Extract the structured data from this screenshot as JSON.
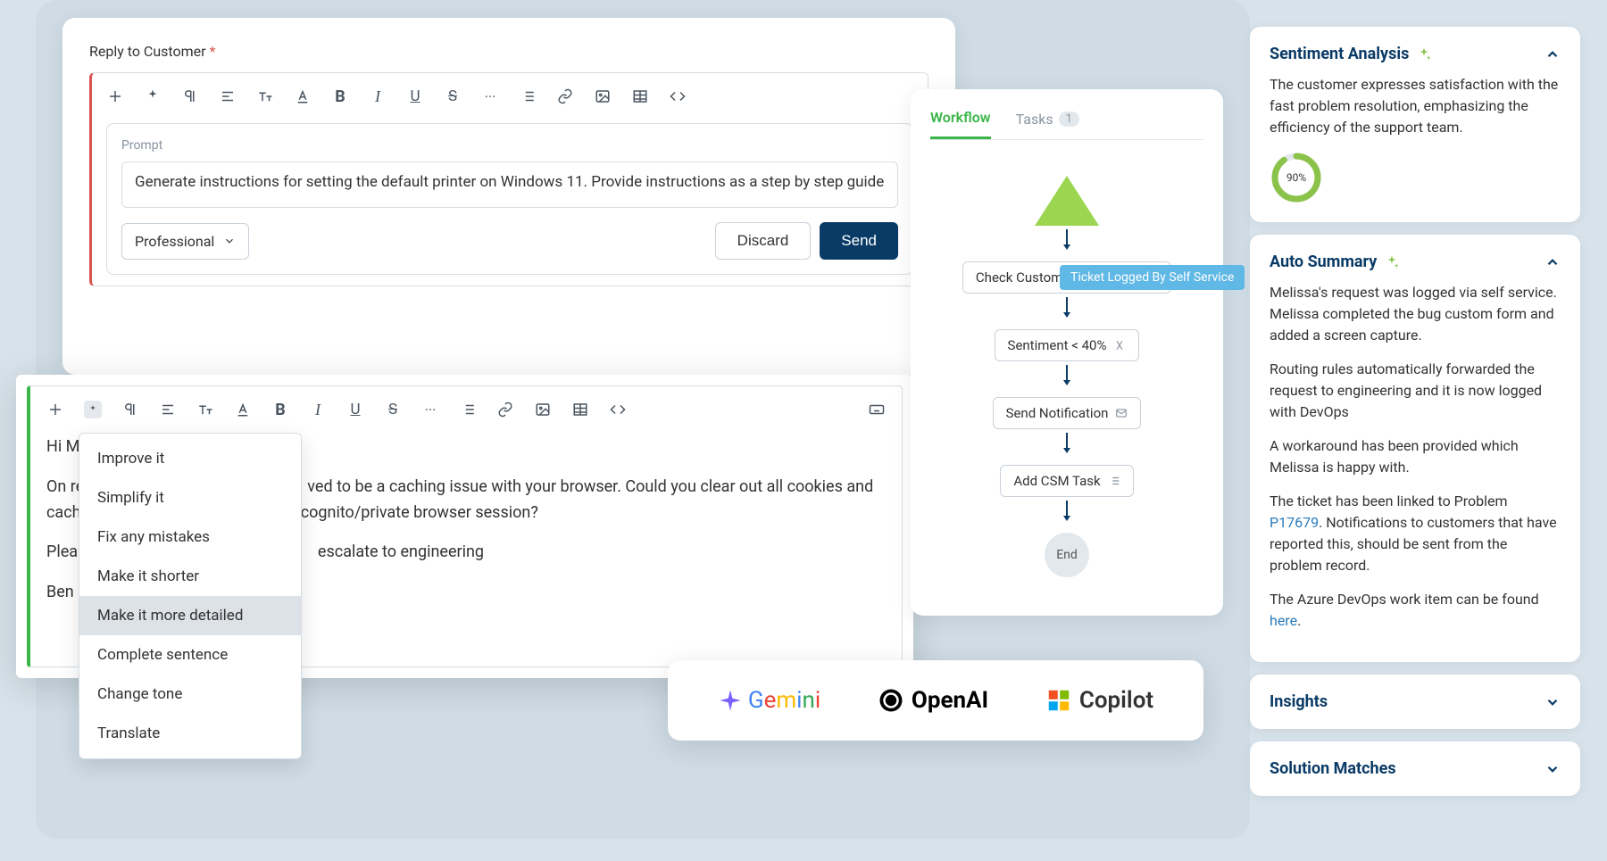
{
  "reply": {
    "label": "Reply to Customer",
    "required": "*",
    "promptLabel": "Prompt",
    "promptText": "Generate instructions for setting the default printer on Windows 11. Provide instructions as a step by step guide",
    "toneSelected": "Professional",
    "discard": "Discard",
    "send": "Send"
  },
  "editor2": {
    "line1": "Hi Me",
    "line2": "On re                                                        ved to be a caching issue with your browser. Could you clear out all cookies and cache                                                     cognito/private browser session?",
    "line3": "Please                                                        escalate to engineering",
    "line4": "Ben"
  },
  "dropdown": {
    "items": [
      "Improve it",
      "Simplify it",
      "Fix any mistakes",
      "Make it shorter",
      "Make it more detailed",
      "Complete sentence",
      "Change tone",
      "Translate"
    ],
    "selectedIndex": 4
  },
  "workflow": {
    "tabs": {
      "workflow": "Workflow",
      "tasks": "Tasks",
      "taskCount": "1"
    },
    "startLabel": "Ticket Logged By Self Service",
    "nodes": [
      "Check Customer Sentiment",
      "Sentiment < 40%",
      "Send Notification",
      "Add CSM Task"
    ],
    "end": "End"
  },
  "sidebar": {
    "sentiment": {
      "title": "Sentiment Analysis",
      "body": "The customer expresses satisfaction with the fast problem resolution, emphasizing the efficiency of the support team.",
      "score": "90%"
    },
    "summary": {
      "title": "Auto Summary",
      "p1": "Melissa's request was logged via self service. Melissa completed the bug custom form and added a screen capture.",
      "p2": "Routing rules automatically forwarded the request to engineering and it is now logged with DevOps",
      "p3": "A workaround has been provided which Melissa is happy with.",
      "p4a": "The ticket has been linked to Problem ",
      "p4link": "P17679",
      "p4b": ". Notifications to customers that have reported this, should be sent from the problem record.",
      "p5a": "The Azure DevOps work item can be found ",
      "p5link": "here",
      "p5b": "."
    },
    "insights": "Insights",
    "solutions": "Solution Matches"
  },
  "integrations": {
    "gemini": "Gemini",
    "openai": "OpenAI",
    "copilot": "Copilot"
  }
}
